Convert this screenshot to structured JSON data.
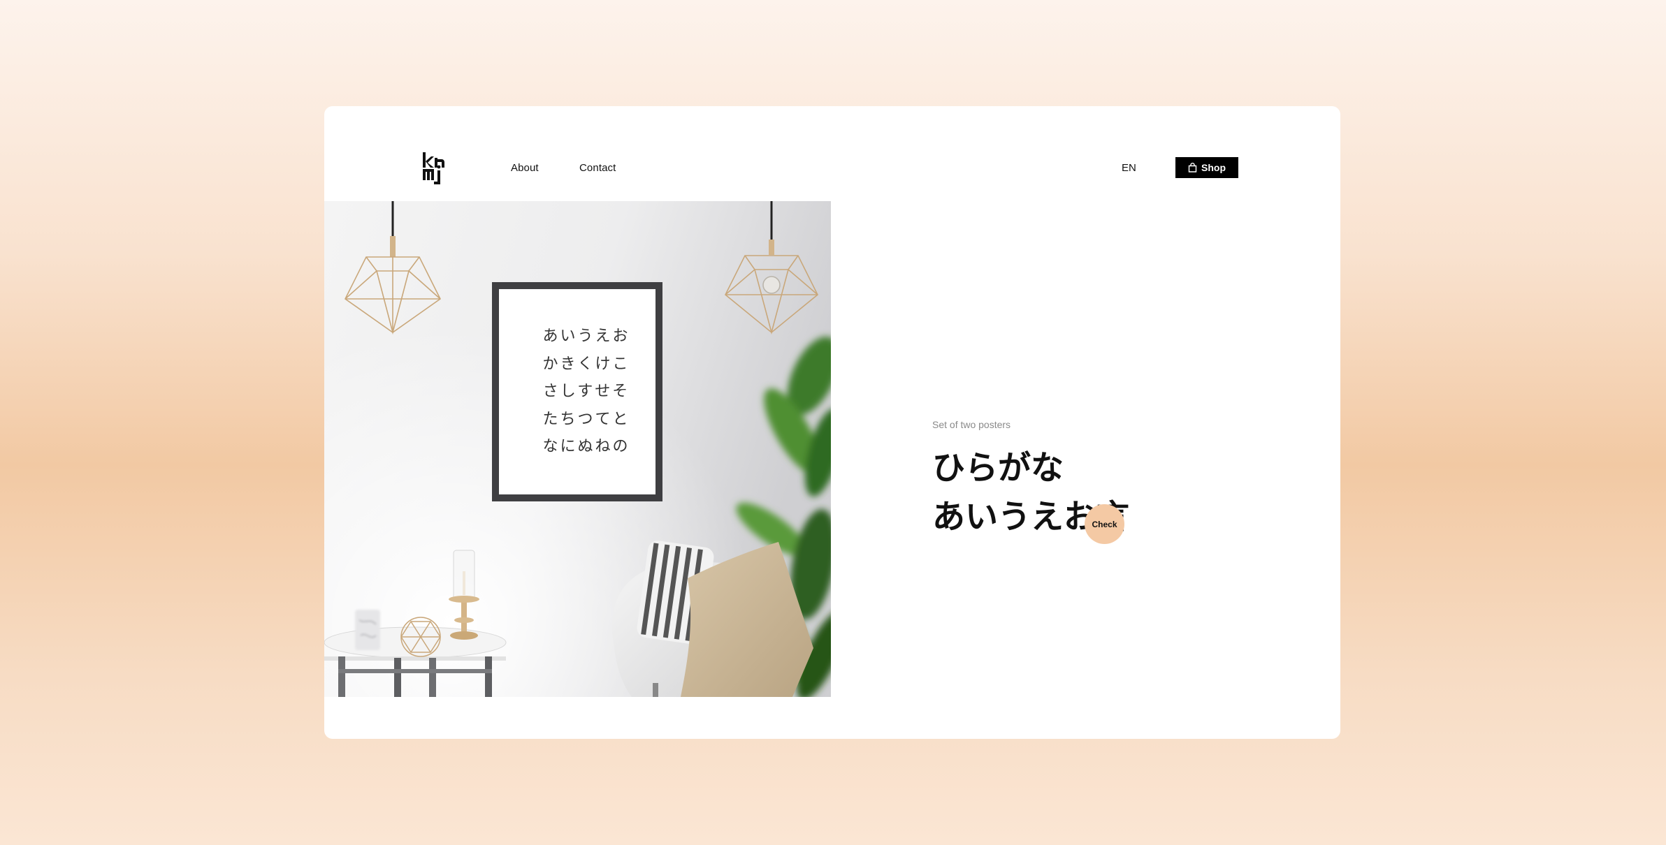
{
  "brand": {
    "logo_icon": "knmj-logo-icon",
    "logo_text": "kn mj"
  },
  "nav": {
    "about": "About",
    "contact": "Contact"
  },
  "header": {
    "language": "EN",
    "shop_label": "Shop",
    "shop_icon": "shopping-bag-icon"
  },
  "poster": {
    "lines": [
      "あいうえお",
      "かきくけこ",
      "さしすせそ",
      "たちつてと",
      "なにぬねの"
    ]
  },
  "product": {
    "subtitle": "Set of two posters",
    "title_line1": "ひらがな",
    "title_line2": "あいうえお言",
    "cta": "Check"
  },
  "colors": {
    "page_bg_top": "#fdf3ec",
    "page_bg_mid": "#f2c9a3",
    "card": "#ffffff",
    "shop_button": "#000000",
    "check_button": "#f4c9a4"
  }
}
